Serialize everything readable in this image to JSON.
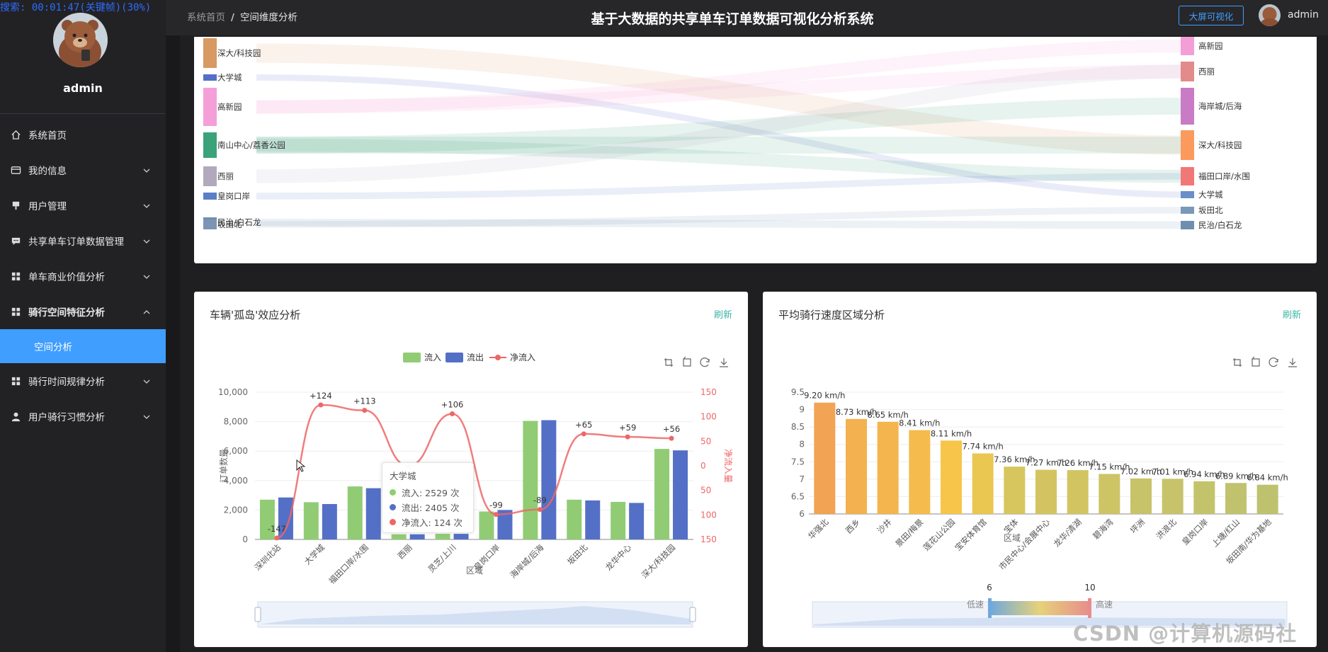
{
  "recording": "搜索: 00:01:47(关键帧)(30%)",
  "user": {
    "name": "admin"
  },
  "sidebar": {
    "items": [
      {
        "label": "系统首页",
        "icon": "home-icon",
        "chev": ""
      },
      {
        "label": "我的信息",
        "icon": "card-icon",
        "chev": "down"
      },
      {
        "label": "用户管理",
        "icon": "flag-icon",
        "chev": "down"
      },
      {
        "label": "共享单车订单数据管理",
        "icon": "chat-icon",
        "chev": "down"
      },
      {
        "label": "单车商业价值分析",
        "icon": "grid-icon",
        "chev": "down"
      },
      {
        "label": "骑行空间特征分析",
        "icon": "grid-icon",
        "chev": "up",
        "bold": true
      },
      {
        "label": "空间分析",
        "icon": "",
        "chev": "",
        "active": true
      },
      {
        "label": "骑行时间规律分析",
        "icon": "grid-icon",
        "chev": "down"
      },
      {
        "label": "用户骑行习惯分析",
        "icon": "user-icon",
        "chev": "down"
      }
    ]
  },
  "header": {
    "breadcrumb_home": "系统首页",
    "breadcrumb_sep": "/",
    "breadcrumb_current": "空间维度分析",
    "title": "基于大数据的共享单车订单数据可视化分析系统",
    "bigscreen_label": "大屏可视化"
  },
  "colors": {
    "accent": "#409eff",
    "inflow": "#91cc75",
    "outflow": "#5470c6",
    "net": "#ee6666"
  },
  "sankey": {
    "left_nodes": [
      "深大/科技园",
      "大学城",
      "高新园",
      "南山中心/荔香公园",
      "西丽",
      "皇岗口岸",
      "民治/白石龙",
      "坂田北"
    ],
    "right_nodes": [
      "高新园",
      "西丽",
      "海岸城/后海",
      "深大/科技园",
      "福田口岸/水围",
      "大学城",
      "坂田北",
      "民治/白石龙"
    ]
  },
  "island": {
    "title": "车辆'孤岛'效应分析",
    "refresh": "刷新",
    "tooltip": {
      "title": "大学城",
      "rows": [
        "流入: 2529 次",
        "流出: 2405 次",
        "净流入: 124 次"
      ]
    }
  },
  "speed": {
    "title": "平均骑行速度区域分析",
    "refresh": "刷新",
    "vm_min": "6",
    "vm_max": "10",
    "vm_low": "低速",
    "vm_high": "高速"
  },
  "watermark": "CSDN @计算机源码社",
  "chart_data": [
    {
      "type": "bar",
      "title": "车辆'孤岛'效应分析",
      "categories": [
        "深圳北站",
        "大学城",
        "福田口岸/水围",
        "西丽",
        "灵芝/上川",
        "皇岗口岸",
        "海岸城/后海",
        "坂田北",
        "龙华中心",
        "深大/科技园"
      ],
      "xlabel": "区域",
      "ylabel": "订单数量",
      "ylabel_right": "净流入量",
      "ylim": [
        0,
        10000
      ],
      "y_ticks": [
        "0",
        "2,000",
        "4,000",
        "6,000",
        "8,000",
        "10,000"
      ],
      "ylim_right": [
        -150,
        150
      ],
      "y_ticks_right": [
        "150",
        "100",
        "50",
        "0",
        "50",
        "100",
        "150"
      ],
      "legend": [
        "流入",
        "流出",
        "净流入"
      ],
      "legend_position": "top",
      "series": [
        {
          "name": "流入",
          "type": "bar",
          "values": [
            2700,
            2529,
            3600,
            350,
            380,
            1900,
            8050,
            2700,
            2550,
            6150
          ]
        },
        {
          "name": "流出",
          "type": "bar",
          "values": [
            2850,
            2405,
            3480,
            350,
            380,
            2000,
            8100,
            2650,
            2480,
            6050
          ]
        },
        {
          "name": "净流入",
          "type": "line",
          "axis": "right",
          "values": [
            -147,
            124,
            113,
            0,
            106,
            -99,
            -89,
            65,
            59,
            56
          ],
          "labels": [
            "-147",
            "+124",
            "+113",
            "",
            "+106",
            "-99",
            "-89",
            "+65",
            "+59",
            "+56"
          ]
        }
      ]
    },
    {
      "type": "bar",
      "title": "平均骑行速度区域分析",
      "categories": [
        "华强北",
        "西乡",
        "沙井",
        "景田/梅景",
        "莲花山公园",
        "宝安体育馆",
        "宝体",
        "市民中心/会展中心",
        "龙华/清湖",
        "碧海湾",
        "坪洲",
        "洪浪北",
        "皇岗口岸",
        "上塘/红山",
        "坂田南/华为基地"
      ],
      "values": [
        9.2,
        8.73,
        8.65,
        8.41,
        8.11,
        7.74,
        7.36,
        7.27,
        7.26,
        7.15,
        7.02,
        7.01,
        6.94,
        6.89,
        6.84
      ],
      "labels": [
        "9.20 km/h",
        "8.73 km/h",
        "8.65 km/h",
        "8.41 km/h",
        "8.11 km/h",
        "7.74 km/h",
        "7.36 km/h",
        "7.27 km/h",
        "7.26 km/h",
        "7.15 km/h",
        "7.02 km/h",
        "7.01 km/h",
        "6.94 km/h",
        "6.89 km/h",
        "6.84 km/h"
      ],
      "xlabel": "区域",
      "ylim": [
        6,
        9.5
      ],
      "y_ticks": [
        "6",
        "6.5",
        "7",
        "7.5",
        "8",
        "8.5",
        "9",
        "9.5"
      ]
    }
  ]
}
